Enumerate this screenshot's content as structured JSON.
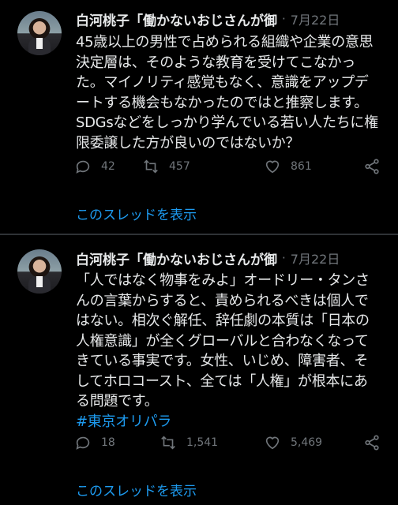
{
  "tweets": [
    {
      "author": "白河桃子「働かないおじさんが御",
      "separator": "·",
      "date": "7月22日",
      "lines": [
        "45歳以上の男性で占められる組織や企業の意思",
        "決定層は、そのような教育を受けてこなかっ",
        "た。マイノリティ感覚もなく、意識をアップデ",
        "ートする機会もなかったのではと推察します。",
        "SDGsなどをしっかり学んでいる若い人たちに権",
        "限委譲した方が良いのではないか？"
      ],
      "hashtag": "",
      "replies": "42",
      "retweets": "457",
      "likes": "861",
      "thread_link": "このスレッドを表示"
    },
    {
      "author": "白河桃子「働かないおじさんが御",
      "separator": "·",
      "date": "7月22日",
      "lines": [
        "「人ではなく物事をみよ」オードリー・タンさ",
        "んの言葉からすると、責められるべきは個人で",
        "はない。相次ぐ解任、辞任劇の本質は「日本の",
        "人権意識」が全くグローバルと合わなくなって",
        "きている事実です。女性、いじめ、障害者、そ",
        "してホロコースト、全ては「人権」が根本にあ",
        "る問題です。"
      ],
      "hashtag": "#東京オリパラ",
      "replies": "18",
      "retweets": "1,541",
      "likes": "5,469",
      "thread_link": "このスレッドを表示"
    }
  ]
}
